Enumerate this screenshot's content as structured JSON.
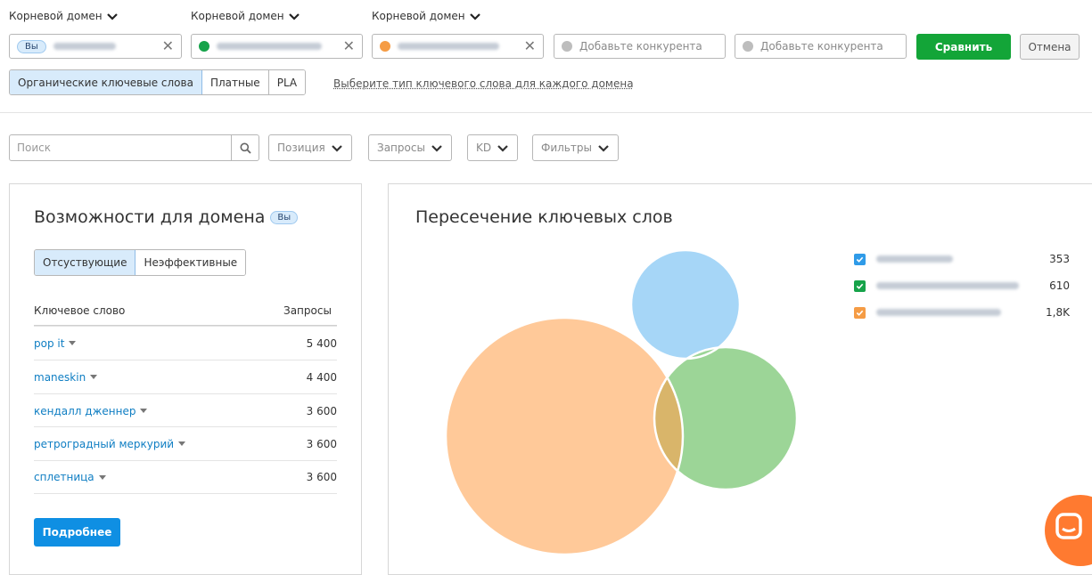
{
  "header": {
    "domain_type_labels": [
      "Корневой домен",
      "Корневой домен",
      "Корневой домен"
    ],
    "you_label": "Вы",
    "add_competitor_placeholders": [
      "Добавьте конкурента",
      "Добавьте конкурента"
    ],
    "compare_label": "Сравнить",
    "cancel_label": "Отмена"
  },
  "keyword_type": {
    "tabs": [
      "Органические ключевые слова",
      "Платные",
      "PLA"
    ],
    "active_index": 0,
    "per_domain_link": "Выберите тип ключевого слова для каждого домена"
  },
  "filters": {
    "search_placeholder": "Поиск",
    "dropdowns": [
      "Позиция",
      "Запросы",
      "KD",
      "Фильтры"
    ]
  },
  "opportunities": {
    "title": "Возможности для домена",
    "badge": "Вы",
    "tabs": [
      "Отсуствующие",
      "Неэффективные"
    ],
    "active_tab": 0,
    "col_keyword": "Ключевое слово",
    "col_volume": "Запросы",
    "rows": [
      {
        "keyword": "pop it",
        "volume": "5 400"
      },
      {
        "keyword": "maneskin",
        "volume": "4 400"
      },
      {
        "keyword": "кендалл дженнер",
        "volume": "3 600"
      },
      {
        "keyword": "ретроградный меркурий",
        "volume": "3 600"
      },
      {
        "keyword": "сплетница",
        "volume": "3 600"
      }
    ],
    "more_label": "Подробнее"
  },
  "overlap": {
    "title": "Пересечение ключевых слов",
    "legend": [
      {
        "count": "353",
        "color": "#2f9be8"
      },
      {
        "count": "610",
        "color": "#16a34a"
      },
      {
        "count": "1,8K",
        "color": "#f59c45"
      }
    ]
  },
  "colors": {
    "accent_green": "#13a538",
    "accent_blue": "#0f8fe3",
    "link_blue": "#0f7ec3",
    "domain1": "#f59c45",
    "domain2": "#16a34a",
    "domain_you": "#2f9be8"
  }
}
